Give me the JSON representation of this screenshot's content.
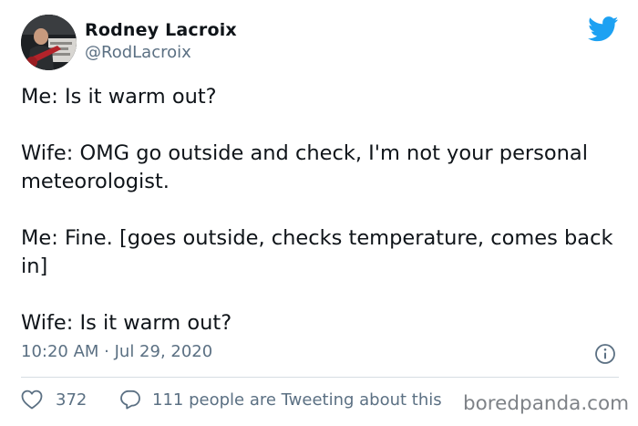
{
  "author": {
    "name": "Rodney Lacroix",
    "handle": "@RodLacroix",
    "avatar_icon": "profile-photo"
  },
  "tweet": {
    "paragraphs": [
      "Me: Is it warm out?",
      "Wife: OMG go outside and check, I'm not your personal meteorologist.",
      "Me: Fine. [goes outside, checks temperature, comes back in]",
      "Wife: Is it warm out?"
    ],
    "timestamp": "10:20 AM · Jul 29, 2020"
  },
  "actions": {
    "likes_count": "372",
    "comments_text": "111 people are Tweeting about this"
  },
  "watermark": "boredpanda.com",
  "colors": {
    "twitter_blue": "#1da1f2",
    "muted_text": "#5b7083",
    "divider": "#d6dde3"
  }
}
